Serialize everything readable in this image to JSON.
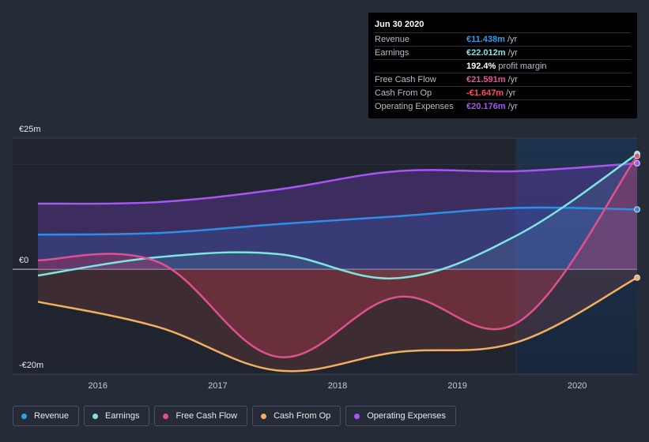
{
  "tooltip": {
    "title": "Jun 30 2020",
    "rows": [
      {
        "label": "Revenue",
        "value": "€11.438m",
        "unit": " /yr",
        "color": "#2e9ef0"
      },
      {
        "label": "Earnings",
        "value": "€22.012m",
        "unit": " /yr",
        "color": "#7ee6e0"
      },
      {
        "label": "",
        "value": "192.4%",
        "unit": " profit margin",
        "color": "#ffffff"
      },
      {
        "label": "Free Cash Flow",
        "value": "€21.591m",
        "unit": " /yr",
        "color": "#e8509a"
      },
      {
        "label": "Cash From Op",
        "value": "-€1.647m",
        "unit": " /yr",
        "color": "#ff4d5e"
      },
      {
        "label": "Operating Expenses",
        "value": "€20.176m",
        "unit": " /yr",
        "color": "#a855f7"
      }
    ]
  },
  "legend": [
    {
      "label": "Revenue",
      "color": "#2e9ef0"
    },
    {
      "label": "Earnings",
      "color": "#7ee6e0"
    },
    {
      "label": "Free Cash Flow",
      "color": "#e0508f"
    },
    {
      "label": "Cash From Op",
      "color": "#f0b060"
    },
    {
      "label": "Operating Expenses",
      "color": "#a855f7"
    }
  ],
  "chart_data": {
    "type": "area",
    "title": "",
    "xlabel": "",
    "ylabel": "",
    "ylim": [
      -20,
      25
    ],
    "y_unit": "€m",
    "y_tick_labels": [
      {
        "value": 25,
        "label": "€25m"
      },
      {
        "value": 0,
        "label": "€0"
      },
      {
        "value": -20,
        "label": "-€20m"
      }
    ],
    "x_range": [
      2015.5,
      2020.5
    ],
    "x_tick_labels": [
      {
        "value": 2016,
        "label": "2016"
      },
      {
        "value": 2017,
        "label": "2017"
      },
      {
        "value": 2018,
        "label": "2018"
      },
      {
        "value": 2019,
        "label": "2019"
      },
      {
        "value": 2020,
        "label": "2020"
      }
    ],
    "highlight_from": 2019.5,
    "x": [
      2015.5,
      2016.5,
      2017.5,
      2018.5,
      2019.5,
      2020.5
    ],
    "series": [
      {
        "name": "Operating Expenses",
        "color": "#a855f7",
        "values": [
          12.5,
          12.8,
          15.2,
          18.7,
          18.7,
          20.2
        ]
      },
      {
        "name": "Revenue",
        "color": "#2e8fe8",
        "values": [
          6.6,
          6.9,
          8.6,
          10.1,
          11.7,
          11.4
        ]
      },
      {
        "name": "Earnings",
        "color": "#7ee6e0",
        "values": [
          -1.2,
          2.3,
          2.9,
          -1.7,
          6.5,
          22.0
        ]
      },
      {
        "name": "Free Cash Flow",
        "color": "#e0508f",
        "values": [
          1.7,
          1.4,
          -16.7,
          -5.3,
          -10.2,
          21.6
        ]
      },
      {
        "name": "Cash From Op",
        "color": "#f0b060",
        "values": [
          -6.2,
          -11.0,
          -19.3,
          -15.8,
          -13.9,
          -1.6
        ]
      }
    ]
  }
}
